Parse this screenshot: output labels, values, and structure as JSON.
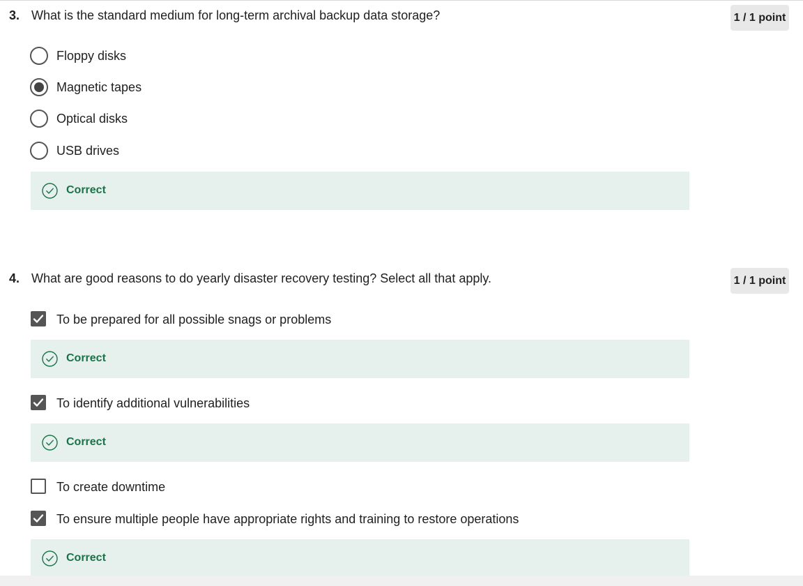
{
  "question3": {
    "number": "3.",
    "text": "What is the standard medium for long-term archival backup data storage?",
    "points": "1 / 1 point",
    "options": [
      {
        "label": "Floppy disks",
        "selected": false
      },
      {
        "label": "Magnetic tapes",
        "selected": true
      },
      {
        "label": "Optical disks",
        "selected": false
      },
      {
        "label": "USB drives",
        "selected": false
      }
    ],
    "feedback": "Correct"
  },
  "question4": {
    "number": "4.",
    "text": "What are good reasons to do yearly disaster recovery testing? Select all that apply.",
    "points": "1 / 1 point",
    "options": [
      {
        "label": "To be prepared for all possible snags or problems",
        "checked": true,
        "feedback": "Correct"
      },
      {
        "label": "To identify additional vulnerabilities",
        "checked": true,
        "feedback": "Correct"
      },
      {
        "label": "To create downtime",
        "checked": false
      },
      {
        "label": "To ensure multiple people have appropriate rights and training to restore operations",
        "checked": true,
        "feedback": "Correct"
      }
    ]
  },
  "colors": {
    "feedback_background": "#e6f1ed",
    "feedback_text": "#1a7348",
    "points_background": "#e8e8e8",
    "control_dark": "#555555"
  },
  "icons": {
    "feedback": "check-circle-icon",
    "checkbox": "checkmark-icon"
  }
}
